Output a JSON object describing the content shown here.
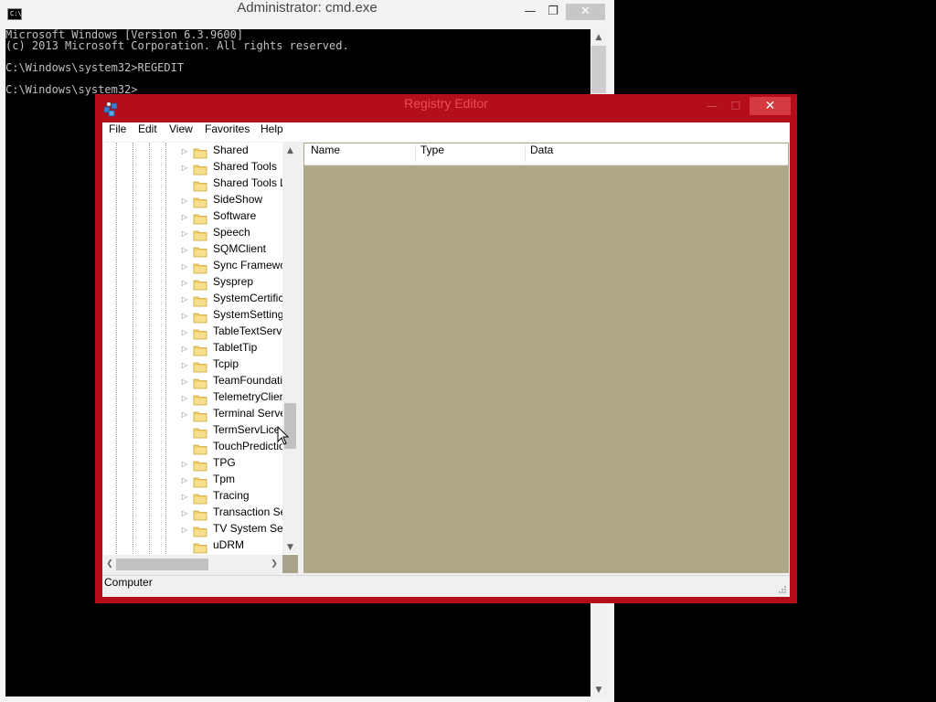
{
  "cmd": {
    "title": "Administrator: cmd.exe",
    "icon_text": "C:\\.",
    "controls": {
      "minimize": "—",
      "maximize": "❐",
      "close": "✕"
    },
    "lines": [
      "Microsoft Windows [Version 6.3.9600]",
      "(c) 2013 Microsoft Corporation. All rights reserved.",
      "",
      "C:\\Windows\\system32>REGEDIT",
      "",
      "C:\\Windows\\system32>"
    ],
    "scroll_up": "▲",
    "scroll_down": "▼"
  },
  "regedit": {
    "title": "Registry Editor",
    "controls": {
      "minimize": "—",
      "maximize": "☐",
      "close": "✕"
    },
    "menu": [
      "File",
      "Edit",
      "View",
      "Favorites",
      "Help"
    ],
    "tree_items": [
      {
        "label": "Shared",
        "expandable": true
      },
      {
        "label": "Shared Tools",
        "expandable": true
      },
      {
        "label": "Shared Tools L",
        "expandable": false
      },
      {
        "label": "SideShow",
        "expandable": true
      },
      {
        "label": "Software",
        "expandable": true
      },
      {
        "label": "Speech",
        "expandable": true
      },
      {
        "label": "SQMClient",
        "expandable": true
      },
      {
        "label": "Sync Framewo",
        "expandable": true
      },
      {
        "label": "Sysprep",
        "expandable": true
      },
      {
        "label": "SystemCertific",
        "expandable": true
      },
      {
        "label": "SystemSetting",
        "expandable": true
      },
      {
        "label": "TableTextServi",
        "expandable": true
      },
      {
        "label": "TabletTip",
        "expandable": true
      },
      {
        "label": "Tcpip",
        "expandable": true
      },
      {
        "label": "TeamFoundati",
        "expandable": true
      },
      {
        "label": "TelemetryClier",
        "expandable": true
      },
      {
        "label": "Terminal Serve",
        "expandable": true
      },
      {
        "label": "TermServLice",
        "expandable": false
      },
      {
        "label": "TouchPredictio",
        "expandable": false
      },
      {
        "label": "TPG",
        "expandable": true
      },
      {
        "label": "Tpm",
        "expandable": true
      },
      {
        "label": "Tracing",
        "expandable": true
      },
      {
        "label": "Transaction Se",
        "expandable": true
      },
      {
        "label": "TV System Ser",
        "expandable": true
      },
      {
        "label": "uDRM",
        "expandable": false
      }
    ],
    "expander_glyph": "▷",
    "columns": {
      "name": "Name",
      "type": "Type",
      "data": "Data"
    },
    "status": "Computer",
    "scroll_glyphs": {
      "up": "▲",
      "down": "▼",
      "left": "❮",
      "right": "❯"
    }
  },
  "colors": {
    "regedit_frame": "#b50e1b",
    "values_pane": "#aea889",
    "folder": "#f2cf6b"
  },
  "icons": {
    "cmd": "command-prompt-icon",
    "regedit": "registry-editor-icon",
    "folder": "folder-icon",
    "cursor": "mouse-pointer-icon"
  }
}
